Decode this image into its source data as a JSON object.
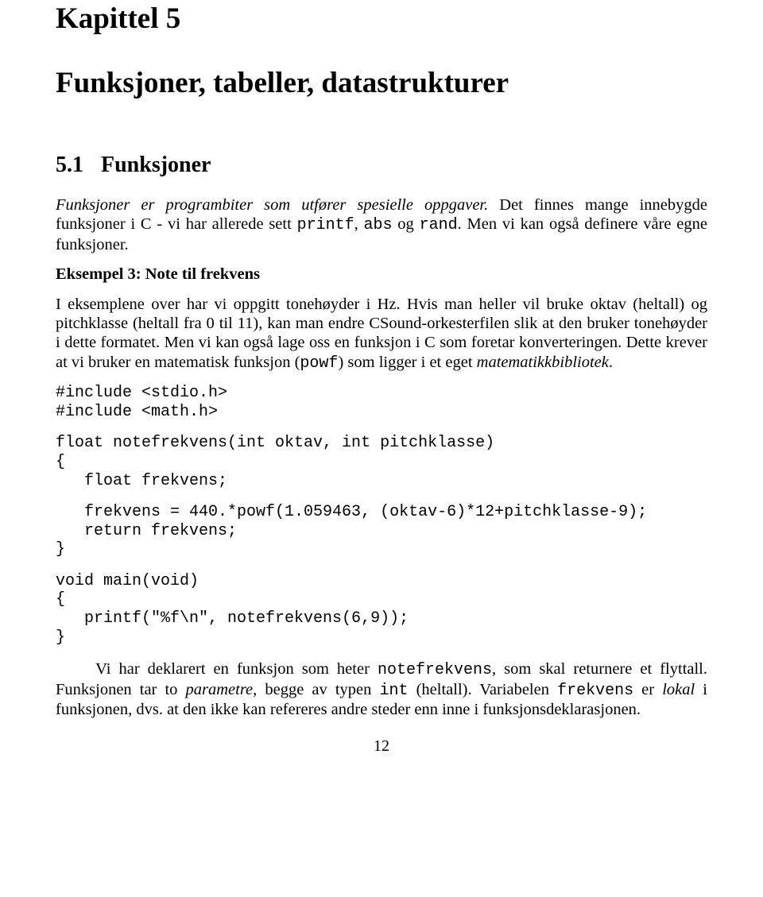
{
  "chapter": {
    "label": "Kapittel 5",
    "title": "Funksjoner, tabeller, datastrukturer"
  },
  "section": {
    "number": "5.1",
    "title": "Funksjoner"
  },
  "para1": {
    "a": "Funksjoner er programbiter som utfører spesielle oppgaver.",
    "b": " Det finnes mange innebygde funksjoner i C - vi har allerede sett ",
    "c1": "printf",
    "sep1": ", ",
    "c2": "abs",
    "sep2": " og ",
    "c3": "rand",
    "d": ". Men vi kan også definere våre egne funksjoner."
  },
  "example": {
    "heading": "Eksempel 3: Note til frekvens"
  },
  "para2": {
    "a": "I eksemplene over har vi oppgitt tonehøyder i Hz. Hvis man heller vil bruke oktav (heltall) og pitchklasse (heltall fra 0 til 11), kan man endre CSound-orkesterfilen slik at den bruker tonehøyder i dette formatet. Men vi kan også lage oss en funksjon i C som foretar konverteringen. Dette krever at vi bruker en matematisk funksjon (",
    "c1": "powf",
    "b": ") som ligger i et eget ",
    "i1": "matematikkbibliotek",
    "c": "."
  },
  "code": {
    "block1": "#include <stdio.h>\n#include <math.h>",
    "block2": "float notefrekvens(int oktav, int pitchklasse)\n{\n   float frekvens;",
    "block3": "   frekvens = 440.*powf(1.059463, (oktav-6)*12+pitchklasse-9);\n   return frekvens;\n}",
    "block4": "void main(void)\n{\n   printf(\"%f\\n\", notefrekvens(6,9));\n}"
  },
  "para3": {
    "indent": "     ",
    "a": "Vi har deklarert en funksjon som heter ",
    "c1": "notefrekvens",
    "b": ", som skal returnere et flyttall. Funksjonen tar to ",
    "i1": "parametre",
    "c": ", begge av typen ",
    "c2": "int",
    "d": " (heltall). Variabelen ",
    "c3": "frekvens",
    "e": " er ",
    "i2": "lokal",
    "f": " i funksjonen, dvs. at den ikke kan refereres andre steder enn inne i funksjonsdeklarasjonen."
  },
  "pageNumber": "12"
}
